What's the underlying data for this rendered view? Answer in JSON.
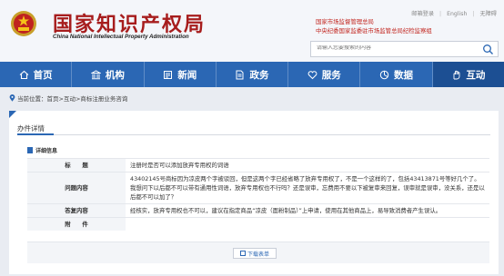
{
  "header": {
    "title": "国家知识产权局",
    "subtitle": "China National Intellectual Property Administration",
    "top_links": [
      "邮箱登录",
      "English",
      "无障碍"
    ],
    "agency_line1": "国家市场监督管理总局",
    "agency_line2": "中央纪委国家监委驻市场监管总局纪检监察组",
    "search_placeholder": "请输入您要搜索的内容"
  },
  "nav": {
    "items": [
      {
        "label": "首页",
        "icon": "home-icon"
      },
      {
        "label": "机构",
        "icon": "institution-icon"
      },
      {
        "label": "新闻",
        "icon": "news-icon"
      },
      {
        "label": "政务",
        "icon": "document-icon"
      },
      {
        "label": "服务",
        "icon": "heart-icon"
      },
      {
        "label": "数据",
        "icon": "chart-icon"
      },
      {
        "label": "互动",
        "icon": "hand-icon"
      }
    ],
    "active_index": 6
  },
  "breadcrumb": {
    "prefix": "当前位置：",
    "path": "首页>互动>商标注册业务咨询"
  },
  "panel": {
    "tab_label": "办件详情",
    "section_title": "详细信息",
    "rows": [
      {
        "label": "标　　题",
        "value": "注册时是否可以添加放弃专用权的词语"
      },
      {
        "label": "问题内容",
        "value": "43402145号商标因为凉皮两个字被驳回，但是这两个字已经省略了放弃专用权了，不是一个这样的了，包括43413871号等好几个了。我想问下以后都不可以带有通用性词语，放弃专用权也不行吗？还是误审，忘费用不要以下被复审来回复，误审就是误审，没关系，还是以后都不可以加了？"
      },
      {
        "label": "答复内容",
        "value": "经核实，放弃专用权也不可以，建议在指定商品“凉皮（面粉制品）”上申请，使用在其他商品上，易导致消费者产生误认。"
      },
      {
        "label": "附　　件",
        "value": ""
      }
    ],
    "download_label": "下载表单"
  },
  "colors": {
    "brand_red": "#a71d1d",
    "nav_blue": "#2b67b4",
    "nav_active": "#1c4f93"
  }
}
